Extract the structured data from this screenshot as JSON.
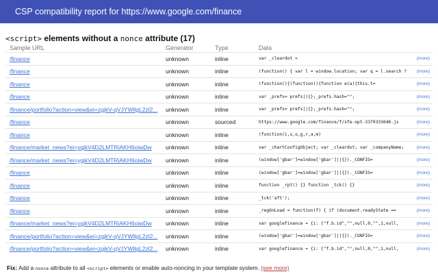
{
  "header": {
    "title": "CSP compatibility report for https://www.google.com/finance"
  },
  "section": {
    "tag": "<script>",
    "text_middle": "elements without a",
    "attr": "nonce",
    "text_end": "attribute (17)"
  },
  "table": {
    "columns": [
      "Sample URL",
      "Generator",
      "Type",
      "Data"
    ],
    "more_label": "(more)",
    "rows": [
      {
        "url": "/finance",
        "generator": "unknown",
        "type": "inline",
        "data": "var _cleardot ="
      },
      {
        "url": "/finance",
        "generator": "unknown",
        "type": "inline",
        "data": "(function() { var l = window.location; var q = l.search ?"
      },
      {
        "url": "/finance",
        "generator": "unknown",
        "type": "inline",
        "data": "(function(){(function(){function e(a){this.t="
      },
      {
        "url": "/finance",
        "generator": "unknown",
        "type": "inline",
        "data": "var _prefs= prefs||{};_prefs.hash=\"\";"
      },
      {
        "url": "/finance/portfolio?action=view&ei=zgjkV-qVJYWllgL2zl2...",
        "generator": "unknown",
        "type": "inline",
        "data": "var _prefs= prefs||{};_prefs.hash=\"\";"
      },
      {
        "url": "/finance",
        "generator": "unknown",
        "type": "sourced",
        "data": "https://www.google.com/finance/f/sfe-opt-3379333646.js"
      },
      {
        "url": "/finance",
        "generator": "unknown",
        "type": "inline",
        "data": "(function(i,s,o,g,r,a,m)"
      },
      {
        "url": "/finance/market_news?ei=ygjkV4D2LMTRiAKH6oiwDw",
        "generator": "unknown",
        "type": "inline",
        "data": "var _chartConfigObject; var _cleardot; var _companyName;"
      },
      {
        "url": "/finance/market_news?ei=ygjkV4D2LMTRiAKH6oiwDw",
        "generator": "unknown",
        "type": "inline",
        "data": "(window['gbar']=window['gbar']||{})._CONFIG="
      },
      {
        "url": "/finance",
        "generator": "unknown",
        "type": "inline",
        "data": "(window['gbar']=window['gbar']||{})._CONFIG="
      },
      {
        "url": "/finance",
        "generator": "unknown",
        "type": "inline",
        "data": "function _rpt() {} function _tck() {}"
      },
      {
        "url": "/finance",
        "generator": "unknown",
        "type": "inline",
        "data": "_tck('aft');"
      },
      {
        "url": "/finance",
        "generator": "unknown",
        "type": "inline",
        "data": "_regOnLoad = function(f) { if (document.readyState =="
      },
      {
        "url": "/finance/market_news?ei=ygjkV4D2LMTRiAKH6oiwDw",
        "generator": "unknown",
        "type": "inline",
        "data": "var googlefinance = {i: [\"f.b.id\",\"\",null,0,\"\",1,null,"
      },
      {
        "url": "/finance/portfolio?action=view&ei=zgjkV-qVJYWllgL2zl2...",
        "generator": "unknown",
        "type": "inline",
        "data": "(window['gbar']=window['gbar']||{})._CONFIG="
      },
      {
        "url": "/finance/portfolio?action=view&ei=zgjkV-qVJYWllgL2zl2...",
        "generator": "unknown",
        "type": "inline",
        "data": "var googlefinance = {i: [\"f.b.id\",\"\",null,0,\"\",1,null,"
      }
    ]
  },
  "fix": {
    "label": "Fix:",
    "text1": "Add a",
    "code1": "nonce",
    "text2": "attribute to all",
    "code2": "<script>",
    "text3": "elements or enable auto-noncing in your template system.",
    "link": "(see more)"
  }
}
